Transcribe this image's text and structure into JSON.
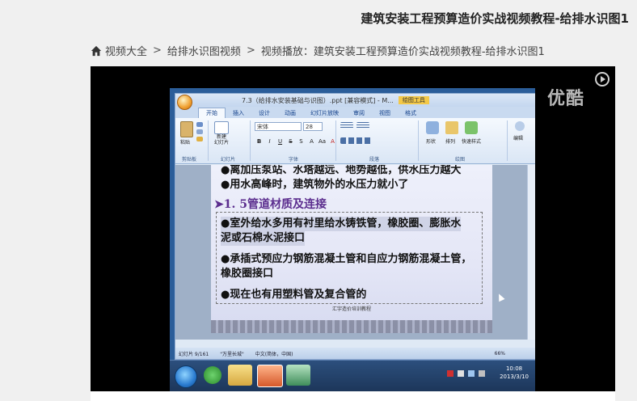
{
  "page": {
    "title": "建筑安装工程预算造价实战视频教程-给排水识图1"
  },
  "breadcrumb": {
    "home_icon": "home-icon",
    "items": [
      "视频大全",
      "给排水识图视频"
    ],
    "current": "视频播放：建筑安装工程预算造价实战视频教程-给排水识图1"
  },
  "video": {
    "watermark": "优酷",
    "ppt": {
      "title_doc": "7.3（给排水安装基础与识图）.ppt [兼容模式] - M...",
      "drawing_tools": "绘图工具",
      "tabs": [
        "开始",
        "插入",
        "设计",
        "动画",
        "幻灯片放映",
        "审阅",
        "视图",
        "格式"
      ],
      "ribbon": {
        "paste": "粘贴",
        "new_slide": "新建\n幻灯片",
        "font_name": "宋体",
        "font_size": "28",
        "groups": [
          "剪贴板",
          "幻灯片",
          "字体",
          "段落",
          "绘图",
          "编辑"
        ],
        "shape": "形状",
        "arrange": "排列",
        "quick_styles": "快速样式",
        "edit": "编辑"
      },
      "slide": {
        "lines": [
          "●离加压泵站、水塔越远、地势越低，供水压力越大",
          "●用水高峰时，建筑物外的水压力就小了",
          "➤1. 5管道材质及连接",
          "●室外给水多用有衬里给水铸铁管，橡胶圈、膨胀水",
          "泥或石棉水泥接口",
          "●承插式预应力钢筋混凝土管和自应力钢筋混凝土管，",
          "橡胶圈接口",
          "●现在也有用塑料管及复合管的"
        ],
        "footer": "汇宇造价培训教程"
      },
      "status": {
        "slide_info": "幻灯片 9/161",
        "theme": "\"万里长城\"",
        "language": "中文(简体，中国)",
        "zoom": "66%"
      }
    },
    "taskbar": {
      "time": "10:08",
      "date": "2013/3/10"
    }
  }
}
